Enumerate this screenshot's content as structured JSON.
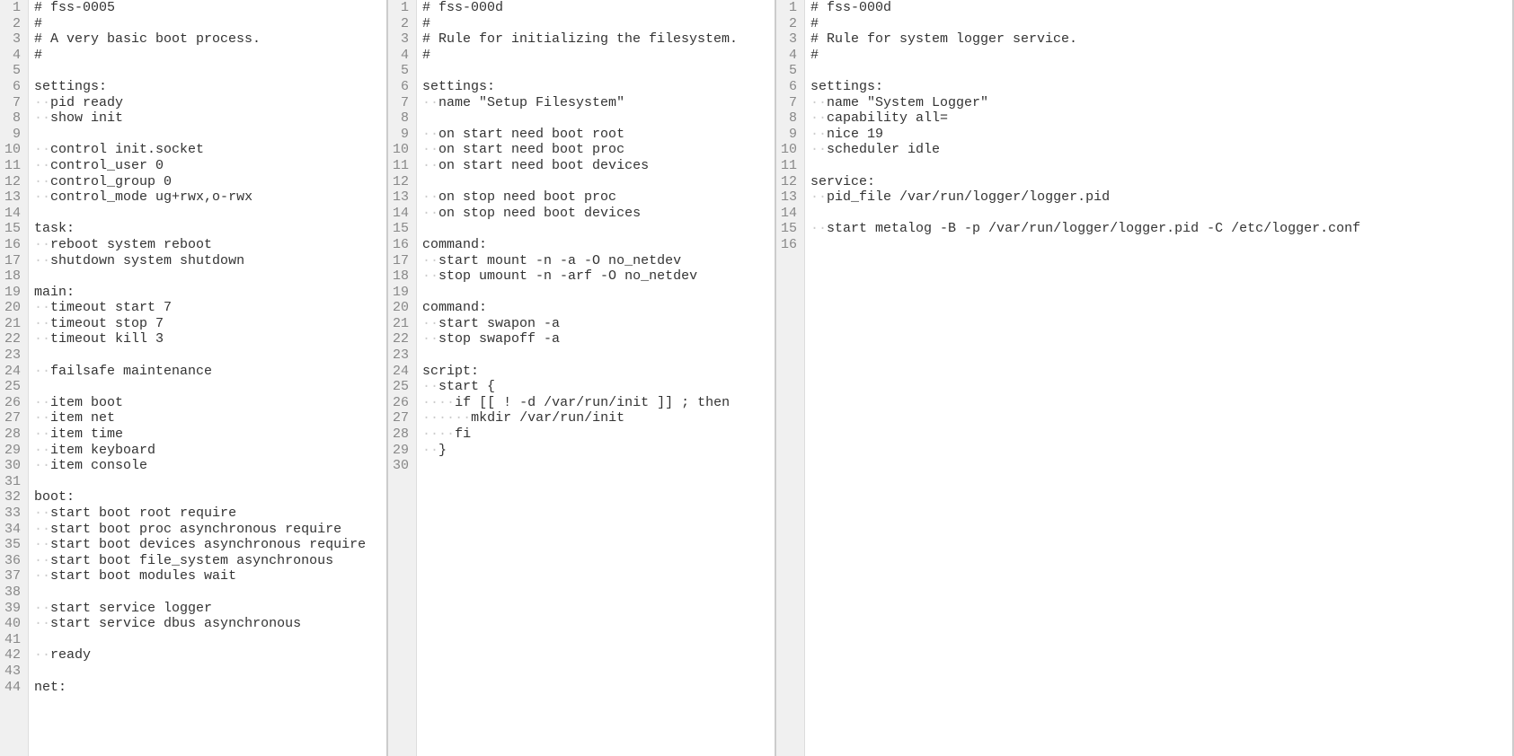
{
  "panes": [
    {
      "lines": [
        "# fss-0005",
        "#",
        "# A very basic boot process.",
        "#",
        "",
        "settings:",
        "  pid ready",
        "  show init",
        "",
        "  control init.socket",
        "  control_user 0",
        "  control_group 0",
        "  control_mode ug+rwx,o-rwx",
        "",
        "task:",
        "  reboot system reboot",
        "  shutdown system shutdown",
        "",
        "main:",
        "  timeout start 7",
        "  timeout stop 7",
        "  timeout kill 3",
        "",
        "  failsafe maintenance",
        "",
        "  item boot",
        "  item net",
        "  item time",
        "  item keyboard",
        "  item console",
        "",
        "boot:",
        "  start boot root require",
        "  start boot proc asynchronous require",
        "  start boot devices asynchronous require",
        "  start boot file_system asynchronous",
        "  start boot modules wait",
        "",
        "  start service logger",
        "  start service dbus asynchronous",
        "",
        "  ready",
        "",
        "net:"
      ],
      "start_line": 1
    },
    {
      "lines": [
        "# fss-000d",
        "#",
        "# Rule for initializing the filesystem.",
        "#",
        "",
        "settings:",
        "  name \"Setup Filesystem\"",
        "",
        "  on start need boot root",
        "  on start need boot proc",
        "  on start need boot devices",
        "",
        "  on stop need boot proc",
        "  on stop need boot devices",
        "",
        "command:",
        "  start mount -n -a -O no_netdev",
        "  stop umount -n -arf -O no_netdev",
        "",
        "command:",
        "  start swapon -a",
        "  stop swapoff -a",
        "",
        "script:",
        "  start {",
        "    if [[ ! -d /var/run/init ]] ; then",
        "      mkdir /var/run/init",
        "    fi",
        "  }",
        ""
      ],
      "start_line": 1
    },
    {
      "lines": [
        "# fss-000d",
        "#",
        "# Rule for system logger service.",
        "#",
        "",
        "settings:",
        "  name \"System Logger\"",
        "  capability all=",
        "  nice 19",
        "  scheduler idle",
        "",
        "service:",
        "  pid_file /var/run/logger/logger.pid",
        "",
        "  start metalog -B -p /var/run/logger/logger.pid -C /etc/logger.conf",
        ""
      ],
      "start_line": 1
    }
  ]
}
